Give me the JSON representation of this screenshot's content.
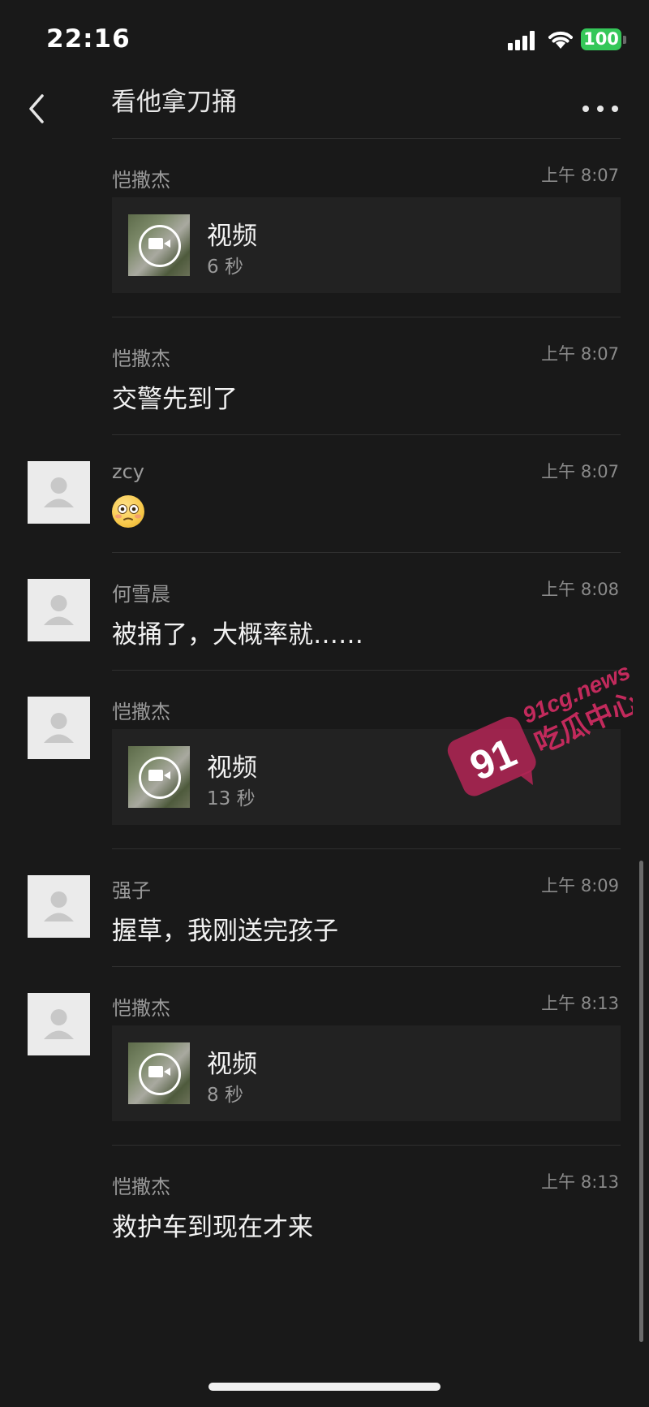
{
  "status_bar": {
    "time": "22:16",
    "battery": "100",
    "icons": [
      "signal-icon",
      "wifi-icon",
      "battery-icon"
    ]
  },
  "nav": {
    "title": "看他拿刀捅",
    "icons": [
      "back-icon",
      "more-icon"
    ]
  },
  "messages": [
    {
      "sender": "恺撒杰",
      "time": "上午 8:07",
      "type": "video",
      "video_label": "视频",
      "duration": "6 秒"
    },
    {
      "sender": "恺撒杰",
      "time": "上午 8:07",
      "type": "text",
      "text": "交警先到了"
    },
    {
      "sender": "zcy",
      "time": "上午 8:07",
      "type": "emoji",
      "emoji": "flushed-face"
    },
    {
      "sender": "何雪晨",
      "time": "上午 8:08",
      "type": "text",
      "text": "被捅了，大概率就……"
    },
    {
      "sender": "恺撒杰",
      "time": "",
      "type": "video",
      "video_label": "视频",
      "duration": "13 秒"
    },
    {
      "sender": "强子",
      "time": "上午 8:09",
      "type": "text",
      "text": "握草，我刚送完孩子"
    },
    {
      "sender": "恺撒杰",
      "time": "上午 8:13",
      "type": "video",
      "video_label": "视频",
      "duration": "8 秒"
    },
    {
      "sender": "恺撒杰",
      "time": "上午 8:13",
      "type": "text",
      "text": "救护车到现在才来"
    }
  ],
  "watermark": {
    "number": "91",
    "domain": "91cg.news",
    "label": "吃瓜中心"
  },
  "colors": {
    "background": "#191919",
    "card": "#222222",
    "accent": "#35c759",
    "watermark": "#b32455"
  }
}
